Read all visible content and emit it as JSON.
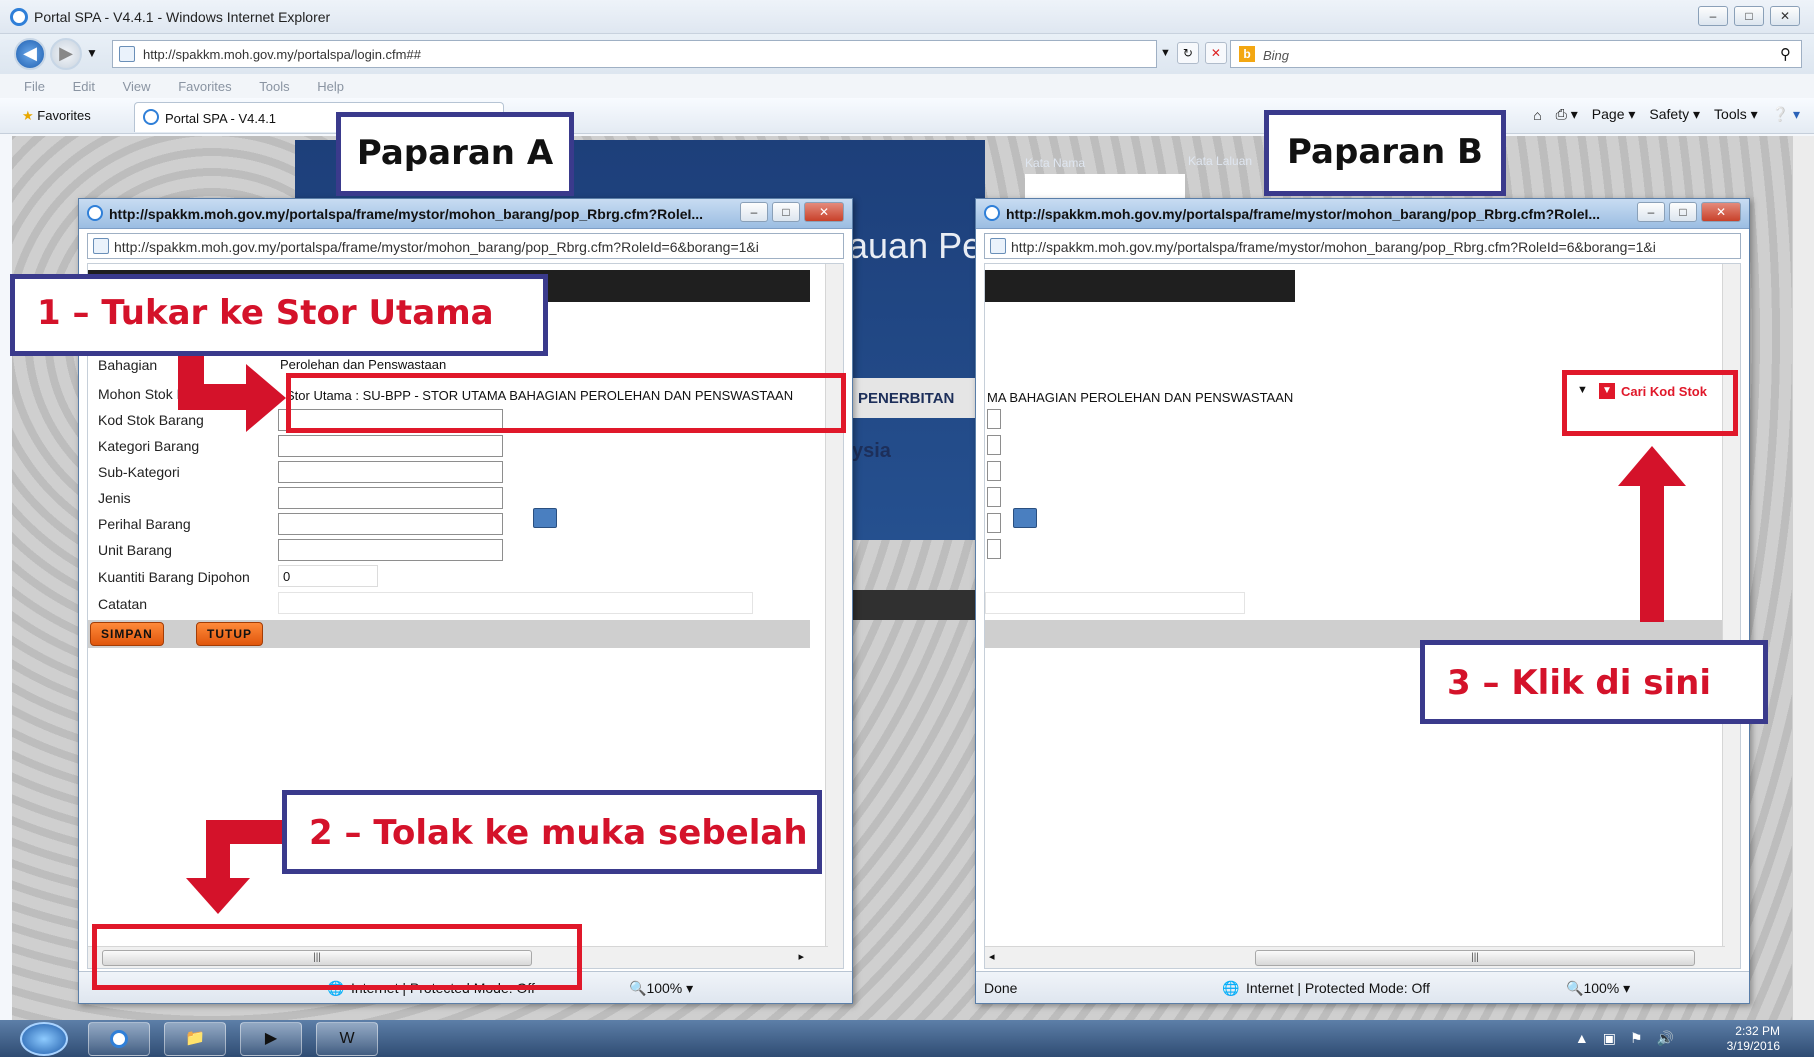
{
  "browser": {
    "window_title": "Portal SPA - V4.4.1 - Windows Internet Explorer",
    "address": "http://spakkm.moh.gov.my/portalspa/login.cfm##",
    "search_placeholder": "Bing",
    "menu": [
      "File",
      "Edit",
      "View",
      "Favorites",
      "Tools",
      "Help"
    ],
    "favorites_label": "Favorites",
    "tab_label": "Portal SPA - V4.4.1",
    "commands": [
      "Page",
      "Safety",
      "Tools"
    ]
  },
  "page": {
    "banner_fragment": "lauan Pe",
    "kata_nama": "Kata Nama",
    "kata_laluan": "Kata Laluan",
    "nav_fragment": "PENERBITAN",
    "sia_fragment": "ysia"
  },
  "popup_a": {
    "title": "http://spakkm.moh.gov.my/portalspa/frame/mystor/mohon_barang/pop_Rbrg.cfm?RoleI...",
    "address": "http://spakkm.moh.gov.my/portalspa/frame/mystor/mohon_barang/pop_Rbrg.cfm?RoleId=6&borang=1&i",
    "fields": [
      {
        "label": "Bahagian",
        "value": "Perolehan dan Penswastaan"
      },
      {
        "label": "Mohon Stok Dari Stor",
        "value": "Stor Utama : SU-BPP - STOR UTAMA BAHAGIAN PEROLEHAN DAN PENSWASTAAN"
      },
      {
        "label": "Kod Stok Barang",
        "value": ""
      },
      {
        "label": "Kategori Barang",
        "value": ""
      },
      {
        "label": "Sub-Kategori",
        "value": ""
      },
      {
        "label": "Jenis",
        "value": ""
      },
      {
        "label": "Perihal Barang",
        "value": ""
      },
      {
        "label": "Unit Barang",
        "value": ""
      },
      {
        "label": "Kuantiti Barang Dipohon",
        "value": "0"
      },
      {
        "label": "Catatan",
        "value": ""
      }
    ],
    "buttons": {
      "save": "SIMPAN",
      "close": "TUTUP"
    },
    "status": "Internet | Protected Mode: Off",
    "zoom": "100%"
  },
  "popup_b": {
    "title": "http://spakkm.moh.gov.my/portalspa/frame/mystor/mohon_barang/pop_Rbrg.cfm?RoleI...",
    "address": "http://spakkm.moh.gov.my/portalspa/frame/mystor/mohon_barang/pop_Rbrg.cfm?RoleId=6&borang=1&i",
    "store_text": "MA BAHAGIAN PEROLEHAN DAN PENSWASTAAN",
    "search_link": "Cari Kod Stok",
    "status_left": "Done",
    "status": "Internet | Protected Mode: Off",
    "zoom": "100%"
  },
  "annotations": {
    "paparan_a": "Paparan A",
    "paparan_b": "Paparan B",
    "step1": "1 – Tukar ke Stor Utama",
    "step2": "2 – Tolak ke muka sebelah",
    "step3": "3 – Klik di sini"
  },
  "taskbar": {
    "time": "2:32 PM",
    "date": "3/19/2016"
  },
  "colors": {
    "callout_border": "#3a3a8c",
    "callout_text": "#d4122a",
    "highlight_border": "#e0182a"
  }
}
